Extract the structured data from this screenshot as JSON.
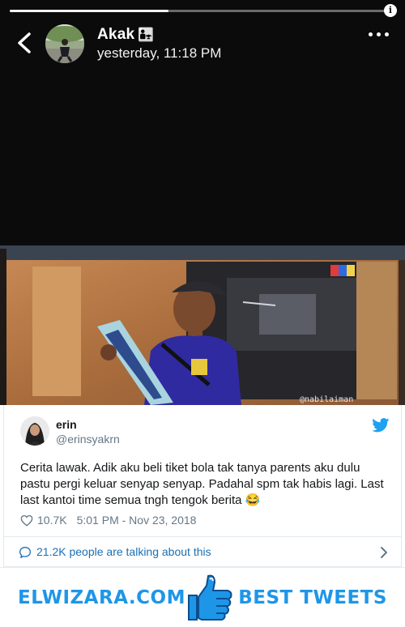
{
  "story": {
    "username": "Akak",
    "username_emoji": "👨‍👧",
    "timestamp": "yesterday, 11:18 PM",
    "progress": 0.42,
    "info_glyph": "i",
    "watermark": "@nabilaiman",
    "channel_logo": "TV3"
  },
  "tweet": {
    "name": "erin",
    "handle": "@erinsyakrn",
    "text": "Cerita lawak. Adik aku beli tiket bola tak tanya parents aku dulu pastu pergi keluar senyap senyap. Padahal spm tak habis lagi. Last last kantoi time semua tngh tengok berita 😂",
    "likes": "10.7K",
    "time": "5:01 PM - Nov 23, 2018",
    "talking": "21.2K people are talking about this"
  },
  "banner": {
    "left_text": "ELWIZARA.COM",
    "right_text": "BEST TWEETS"
  },
  "colors": {
    "twitter_blue": "#1da1f2",
    "banner_blue": "#1e96e8",
    "link_blue": "#1b6fb5"
  },
  "icons": [
    "back-chevron-icon",
    "more-dots-icon",
    "info-icon",
    "twitter-bird-icon",
    "heart-icon",
    "speech-bubble-icon",
    "chevron-right-icon",
    "thumbs-up-icon"
  ]
}
